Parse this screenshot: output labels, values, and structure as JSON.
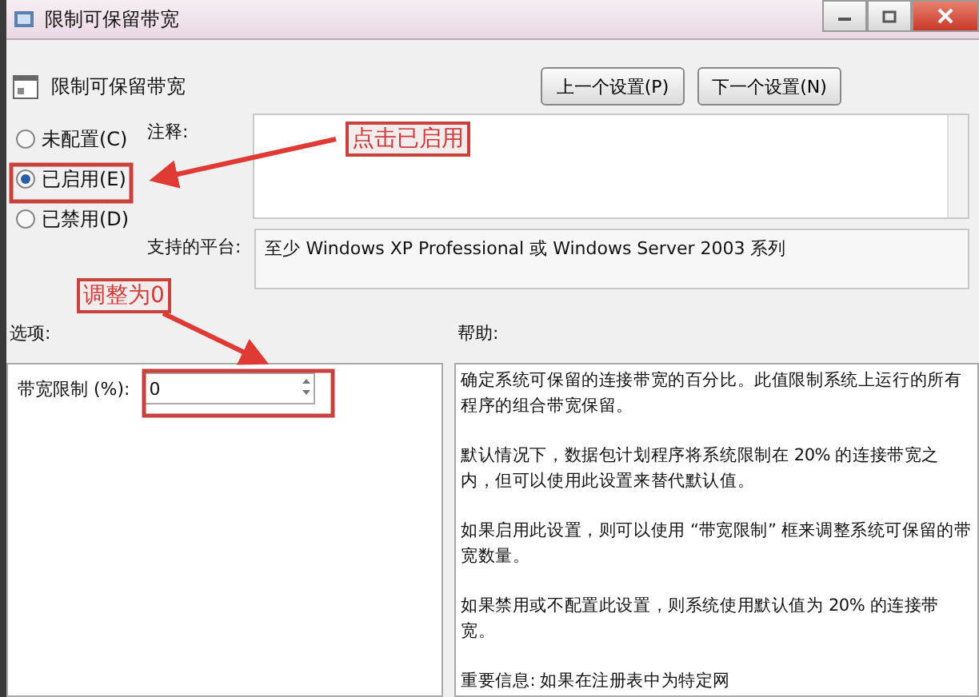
{
  "window": {
    "title": "限制可保留带宽"
  },
  "header": {
    "title": "限制可保留带宽",
    "buttons": [
      "上一个设置(P)",
      "下一个设置(N)"
    ]
  },
  "state_options": [
    {
      "label": "未配置(C)",
      "selected": false
    },
    {
      "label": "已启用(E)",
      "selected": true
    },
    {
      "label": "已禁用(D)",
      "selected": false
    }
  ],
  "comment": {
    "label": "注释:"
  },
  "platform": {
    "label": "支持的平台:",
    "value": "至少 Windows XP Professional 或 Windows Server 2003 系列"
  },
  "options": {
    "label": "选项:",
    "field": {
      "label": "带宽限制 (%):",
      "value": "0"
    }
  },
  "help": {
    "label": "帮助:",
    "paragraphs": [
      "确定系统可保留的连接带宽的百分比。此值限制系统上运行的所有程序的组合带宽保留。",
      "默认情况下，数据包计划程序将系统限制在 20% 的连接带宽之内，但可以使用此设置来替代默认值。",
      "如果启用此设置，则可以使用 “带宽限制” 框来调整系统可保留的带宽数量。",
      "如果禁用或不配置此设置，则系统使用默认值为 20% 的连接带宽。",
      "重要信息: 如果在注册表中为特定网"
    ]
  },
  "annotations": [
    {
      "text": "点击已启用"
    },
    {
      "text": "调整为0"
    }
  ]
}
